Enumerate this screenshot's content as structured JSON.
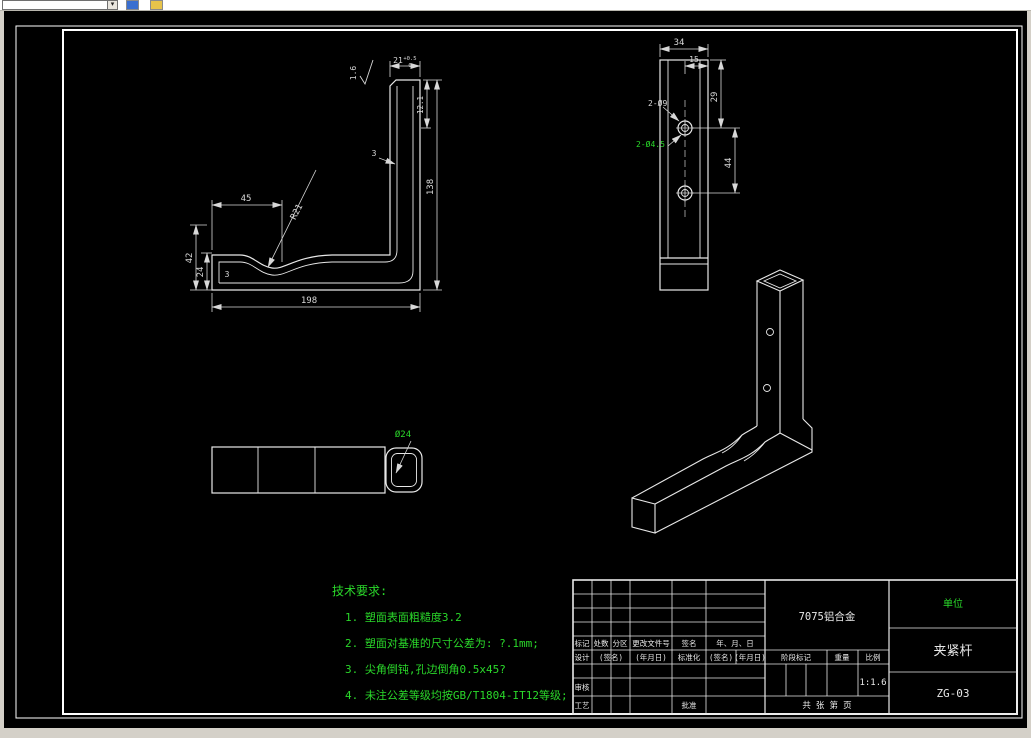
{
  "front_view": {
    "dim_45": "45",
    "dim_42": "42",
    "dim_24": "24",
    "wall_3_left": "3",
    "wall_3_right": "3",
    "dim_198": "198",
    "dim_138": "138",
    "dim_12_1": "12.1",
    "radius_label": "R21",
    "roughness": "1.6",
    "dim_21": "21",
    "tol_upper": "+0.5",
    "tol_lower": "0"
  },
  "side_view": {
    "dim_34": "34",
    "dim_15": "15",
    "dim_29": "29",
    "dim_44": "44",
    "label_holes_9": "2-Ø9",
    "label_holes_45": "2-Ø4.5"
  },
  "bottom_view": {
    "label_dia24": "Ø24"
  },
  "tech_req": {
    "title": "技术要求:",
    "items": [
      "1. 塑面表面粗糙度3.2",
      "2. 塑面对基准的尺寸公差为: ?.1mm;",
      "3. 尖角倒钝,孔边倒角0.5x45?",
      "4. 未注公差等级均按GB/T1804-IT12等级;"
    ]
  },
  "title_block": {
    "material": "7075铝合金",
    "company": "单位",
    "part_name": "夹紧杆",
    "drawing_no": "ZG-03",
    "scale_value": "1:1.6",
    "col_mark": "标记",
    "col_count": "处数",
    "col_zone": "分区",
    "col_change_file": "更改文件号",
    "col_sign": "签名",
    "col_date": "年、月、日",
    "design": "设计",
    "sign_placeholder": "(签名)",
    "date_placeholder": "(年月日)",
    "standardization": "标准化",
    "sign_placeholder2": "(签名)",
    "date_placeholder2": "(年月日)",
    "review": "审核",
    "process": "工艺",
    "approve": "批准",
    "stage_mark": "阶段标记",
    "weight": "重量",
    "scale_label": "比例",
    "sheet_info": "共  张  第  页"
  },
  "colors": {
    "background": "#000000",
    "line": "#e8e8e8",
    "dim": "#d8d8d8",
    "green": "#2ad82a",
    "frame": "#ffffff"
  }
}
